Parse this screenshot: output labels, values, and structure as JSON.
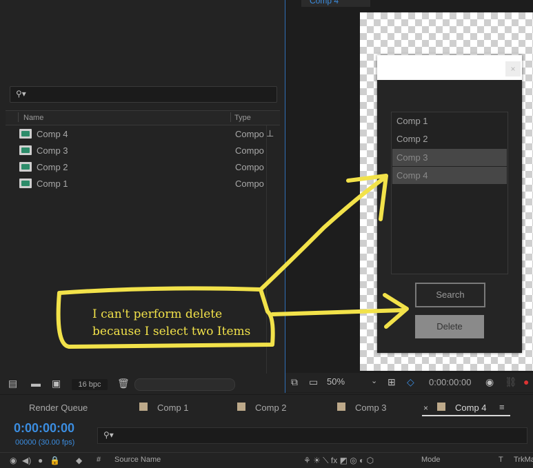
{
  "project": {
    "search_icon": "search-icon",
    "columns": {
      "name": "Name",
      "type": "Type"
    },
    "items": [
      {
        "name": "Comp 4",
        "type": "Compo"
      },
      {
        "name": "Comp 3",
        "type": "Compo"
      },
      {
        "name": "Comp 2",
        "type": "Compo"
      },
      {
        "name": "Comp 1",
        "type": "Compo"
      }
    ],
    "bpc": "16 bpc"
  },
  "viewer": {
    "tab": "Comp 4",
    "zoom": "50%",
    "time": "0:00:00:00"
  },
  "dialog": {
    "close": "×",
    "list": [
      {
        "label": "Comp 1",
        "selected": false
      },
      {
        "label": "Comp 2",
        "selected": false
      },
      {
        "label": "Comp 3",
        "selected": true
      },
      {
        "label": "Comp 4",
        "selected": true
      }
    ],
    "search_label": "Search",
    "delete_label": "Delete"
  },
  "timeline": {
    "tabs": [
      "Render Queue",
      "Comp 1",
      "Comp 2",
      "Comp 3",
      "Comp 4"
    ],
    "active_tab": "Comp 4",
    "close": "×",
    "menu": "≡",
    "timecode": "0:00:00:00",
    "fps": "00000 (30.00 fps)",
    "headers": {
      "hash": "#",
      "source": "Source Name",
      "mode": "Mode",
      "t": "T",
      "trkmat": "TrkMa"
    }
  },
  "annotation": {
    "text": "I can't perform delete\nbecause I select two Items",
    "color": "#f2e24a"
  }
}
